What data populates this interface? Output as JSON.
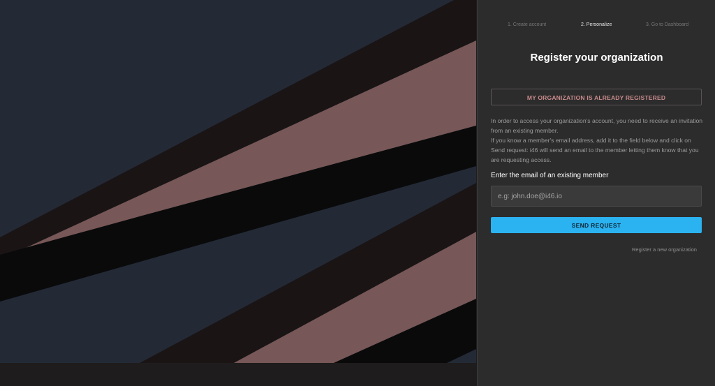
{
  "steps": [
    {
      "label": "1. Create account",
      "active": false
    },
    {
      "label": "2. Personalize",
      "active": true
    },
    {
      "label": "3. Go to Dashboard",
      "active": false
    }
  ],
  "form": {
    "title": "Register your organization",
    "already_registered_label": "MY ORGANIZATION IS ALREADY REGISTERED",
    "info_lines": [
      "In order to access your organization's account, you need to receive an invitation from an existing member.",
      "If you know a member's email address, add it to the field below and click on Send request: i46 will send an email to the member letting them know that you are requesting access."
    ],
    "email_label": "Enter the email of an existing member",
    "email_value": "",
    "email_placeholder": "e.g: john.doe@i46.io",
    "send_label": "SEND REQUEST",
    "register_new_label": "Register a new organization"
  },
  "colors": {
    "hero_background": "#232a36",
    "stripe_dark": "#1a1415",
    "stripe_pink": "#775757",
    "stripe_black": "#0a0a0b",
    "panel_background": "#2c2c2d",
    "send_button": "#2bb2f0",
    "registered_button_text": "#c98a8a"
  }
}
